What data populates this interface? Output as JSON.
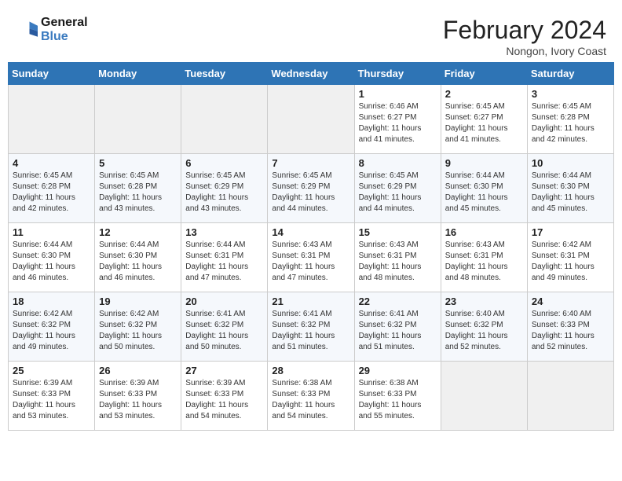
{
  "header": {
    "logo_line1": "General",
    "logo_line2": "Blue",
    "month_year": "February 2024",
    "location": "Nongon, Ivory Coast"
  },
  "weekdays": [
    "Sunday",
    "Monday",
    "Tuesday",
    "Wednesday",
    "Thursday",
    "Friday",
    "Saturday"
  ],
  "weeks": [
    [
      {
        "day": "",
        "info": ""
      },
      {
        "day": "",
        "info": ""
      },
      {
        "day": "",
        "info": ""
      },
      {
        "day": "",
        "info": ""
      },
      {
        "day": "1",
        "info": "Sunrise: 6:46 AM\nSunset: 6:27 PM\nDaylight: 11 hours and 41 minutes."
      },
      {
        "day": "2",
        "info": "Sunrise: 6:45 AM\nSunset: 6:27 PM\nDaylight: 11 hours and 41 minutes."
      },
      {
        "day": "3",
        "info": "Sunrise: 6:45 AM\nSunset: 6:28 PM\nDaylight: 11 hours and 42 minutes."
      }
    ],
    [
      {
        "day": "4",
        "info": "Sunrise: 6:45 AM\nSunset: 6:28 PM\nDaylight: 11 hours and 42 minutes."
      },
      {
        "day": "5",
        "info": "Sunrise: 6:45 AM\nSunset: 6:28 PM\nDaylight: 11 hours and 43 minutes."
      },
      {
        "day": "6",
        "info": "Sunrise: 6:45 AM\nSunset: 6:29 PM\nDaylight: 11 hours and 43 minutes."
      },
      {
        "day": "7",
        "info": "Sunrise: 6:45 AM\nSunset: 6:29 PM\nDaylight: 11 hours and 44 minutes."
      },
      {
        "day": "8",
        "info": "Sunrise: 6:45 AM\nSunset: 6:29 PM\nDaylight: 11 hours and 44 minutes."
      },
      {
        "day": "9",
        "info": "Sunrise: 6:44 AM\nSunset: 6:30 PM\nDaylight: 11 hours and 45 minutes."
      },
      {
        "day": "10",
        "info": "Sunrise: 6:44 AM\nSunset: 6:30 PM\nDaylight: 11 hours and 45 minutes."
      }
    ],
    [
      {
        "day": "11",
        "info": "Sunrise: 6:44 AM\nSunset: 6:30 PM\nDaylight: 11 hours and 46 minutes."
      },
      {
        "day": "12",
        "info": "Sunrise: 6:44 AM\nSunset: 6:30 PM\nDaylight: 11 hours and 46 minutes."
      },
      {
        "day": "13",
        "info": "Sunrise: 6:44 AM\nSunset: 6:31 PM\nDaylight: 11 hours and 47 minutes."
      },
      {
        "day": "14",
        "info": "Sunrise: 6:43 AM\nSunset: 6:31 PM\nDaylight: 11 hours and 47 minutes."
      },
      {
        "day": "15",
        "info": "Sunrise: 6:43 AM\nSunset: 6:31 PM\nDaylight: 11 hours and 48 minutes."
      },
      {
        "day": "16",
        "info": "Sunrise: 6:43 AM\nSunset: 6:31 PM\nDaylight: 11 hours and 48 minutes."
      },
      {
        "day": "17",
        "info": "Sunrise: 6:42 AM\nSunset: 6:31 PM\nDaylight: 11 hours and 49 minutes."
      }
    ],
    [
      {
        "day": "18",
        "info": "Sunrise: 6:42 AM\nSunset: 6:32 PM\nDaylight: 11 hours and 49 minutes."
      },
      {
        "day": "19",
        "info": "Sunrise: 6:42 AM\nSunset: 6:32 PM\nDaylight: 11 hours and 50 minutes."
      },
      {
        "day": "20",
        "info": "Sunrise: 6:41 AM\nSunset: 6:32 PM\nDaylight: 11 hours and 50 minutes."
      },
      {
        "day": "21",
        "info": "Sunrise: 6:41 AM\nSunset: 6:32 PM\nDaylight: 11 hours and 51 minutes."
      },
      {
        "day": "22",
        "info": "Sunrise: 6:41 AM\nSunset: 6:32 PM\nDaylight: 11 hours and 51 minutes."
      },
      {
        "day": "23",
        "info": "Sunrise: 6:40 AM\nSunset: 6:32 PM\nDaylight: 11 hours and 52 minutes."
      },
      {
        "day": "24",
        "info": "Sunrise: 6:40 AM\nSunset: 6:33 PM\nDaylight: 11 hours and 52 minutes."
      }
    ],
    [
      {
        "day": "25",
        "info": "Sunrise: 6:39 AM\nSunset: 6:33 PM\nDaylight: 11 hours and 53 minutes."
      },
      {
        "day": "26",
        "info": "Sunrise: 6:39 AM\nSunset: 6:33 PM\nDaylight: 11 hours and 53 minutes."
      },
      {
        "day": "27",
        "info": "Sunrise: 6:39 AM\nSunset: 6:33 PM\nDaylight: 11 hours and 54 minutes."
      },
      {
        "day": "28",
        "info": "Sunrise: 6:38 AM\nSunset: 6:33 PM\nDaylight: 11 hours and 54 minutes."
      },
      {
        "day": "29",
        "info": "Sunrise: 6:38 AM\nSunset: 6:33 PM\nDaylight: 11 hours and 55 minutes."
      },
      {
        "day": "",
        "info": ""
      },
      {
        "day": "",
        "info": ""
      }
    ]
  ]
}
